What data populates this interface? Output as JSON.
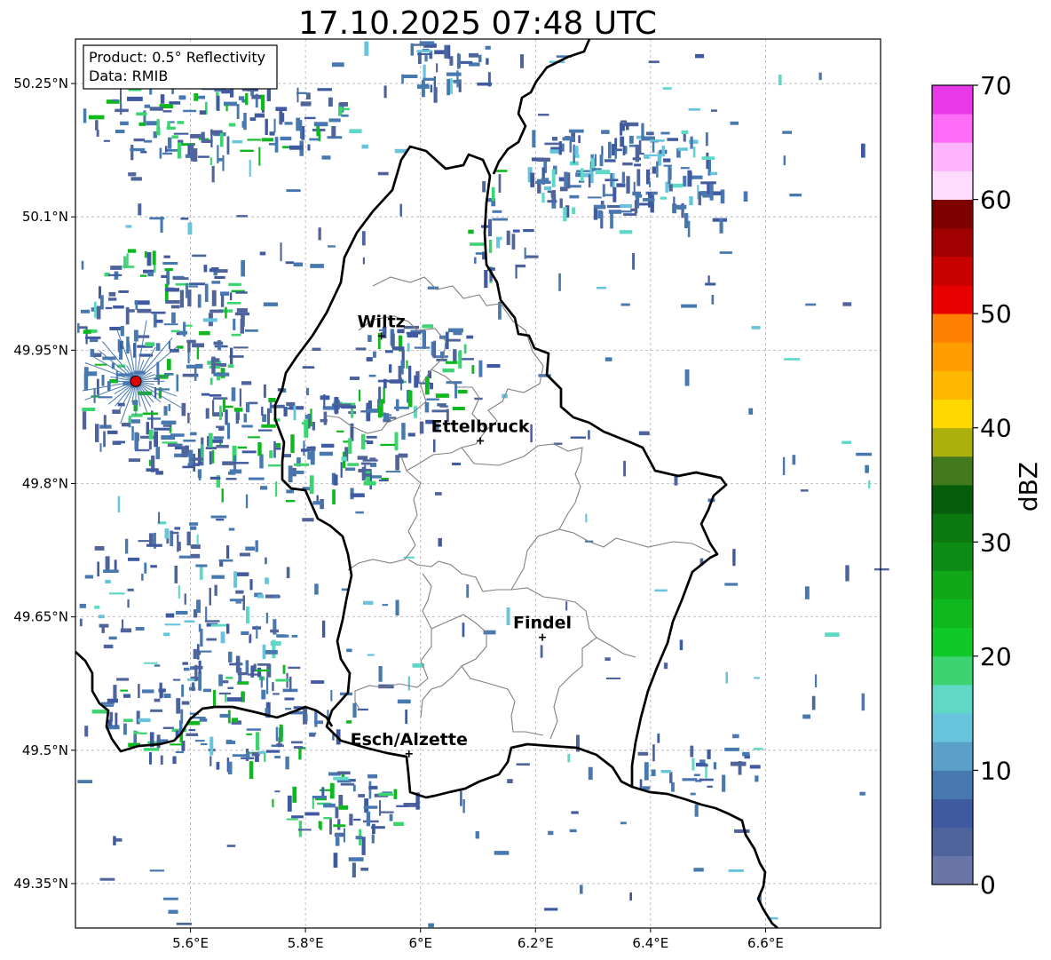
{
  "title": "17.10.2025 07:48 UTC",
  "info_box": {
    "product": "Product: 0.5° Reflectivity",
    "data_source": "Data: RMIB"
  },
  "map": {
    "lon_range": [
      5.4,
      6.8
    ],
    "lat_range": [
      49.3,
      50.3
    ],
    "lon_ticks": [
      5.6,
      5.8,
      6.0,
      6.2,
      6.4,
      6.6
    ],
    "lon_tick_labels": [
      "5.6°E",
      "5.8°E",
      "6°E",
      "6.2°E",
      "6.4°E",
      "6.6°E"
    ],
    "lat_ticks": [
      50.25,
      50.1,
      49.95,
      49.8,
      49.65,
      49.5,
      49.35
    ],
    "lat_tick_labels": [
      "50.25°N",
      "50.1°N",
      "49.95°N",
      "49.8°N",
      "49.65°N",
      "49.5°N",
      "49.35°N"
    ],
    "grid": true,
    "colors": {
      "grid": "#b0b0b0",
      "country_border": "#000000",
      "canton_border": "#808080",
      "radar_marker": "#e00000"
    },
    "radar_site": {
      "lon": 5.505,
      "lat": 49.915
    },
    "cities": [
      {
        "name": "Wiltz",
        "lon": 5.932,
        "lat": 49.966
      },
      {
        "name": "Ettelbruck",
        "lon": 6.104,
        "lat": 49.848
      },
      {
        "name": "Findel",
        "lon": 6.212,
        "lat": 49.627
      },
      {
        "name": "Esch/Alzette",
        "lon": 5.98,
        "lat": 49.496
      }
    ]
  },
  "colorbar": {
    "unit": "dBZ",
    "min": 0,
    "max": 70,
    "ticks": [
      "0",
      "10",
      "20",
      "30",
      "40",
      "50",
      "60",
      "70"
    ],
    "colors": [
      "#6a76a8",
      "#50649c",
      "#3f5aa0",
      "#4878b0",
      "#5ba0c8",
      "#68c4dc",
      "#60d8c8",
      "#3cd470",
      "#10c828",
      "#10b820",
      "#10a818",
      "#0c8c14",
      "#0c7810",
      "#065e0c",
      "#44781c",
      "#acb00c",
      "#ffd800",
      "#ffb800",
      "#ff9c00",
      "#ff8000",
      "#e80000",
      "#c80000",
      "#a00000",
      "#800000",
      "#ffdcff",
      "#ffb4ff",
      "#ff6cf8",
      "#e838e8"
    ]
  }
}
